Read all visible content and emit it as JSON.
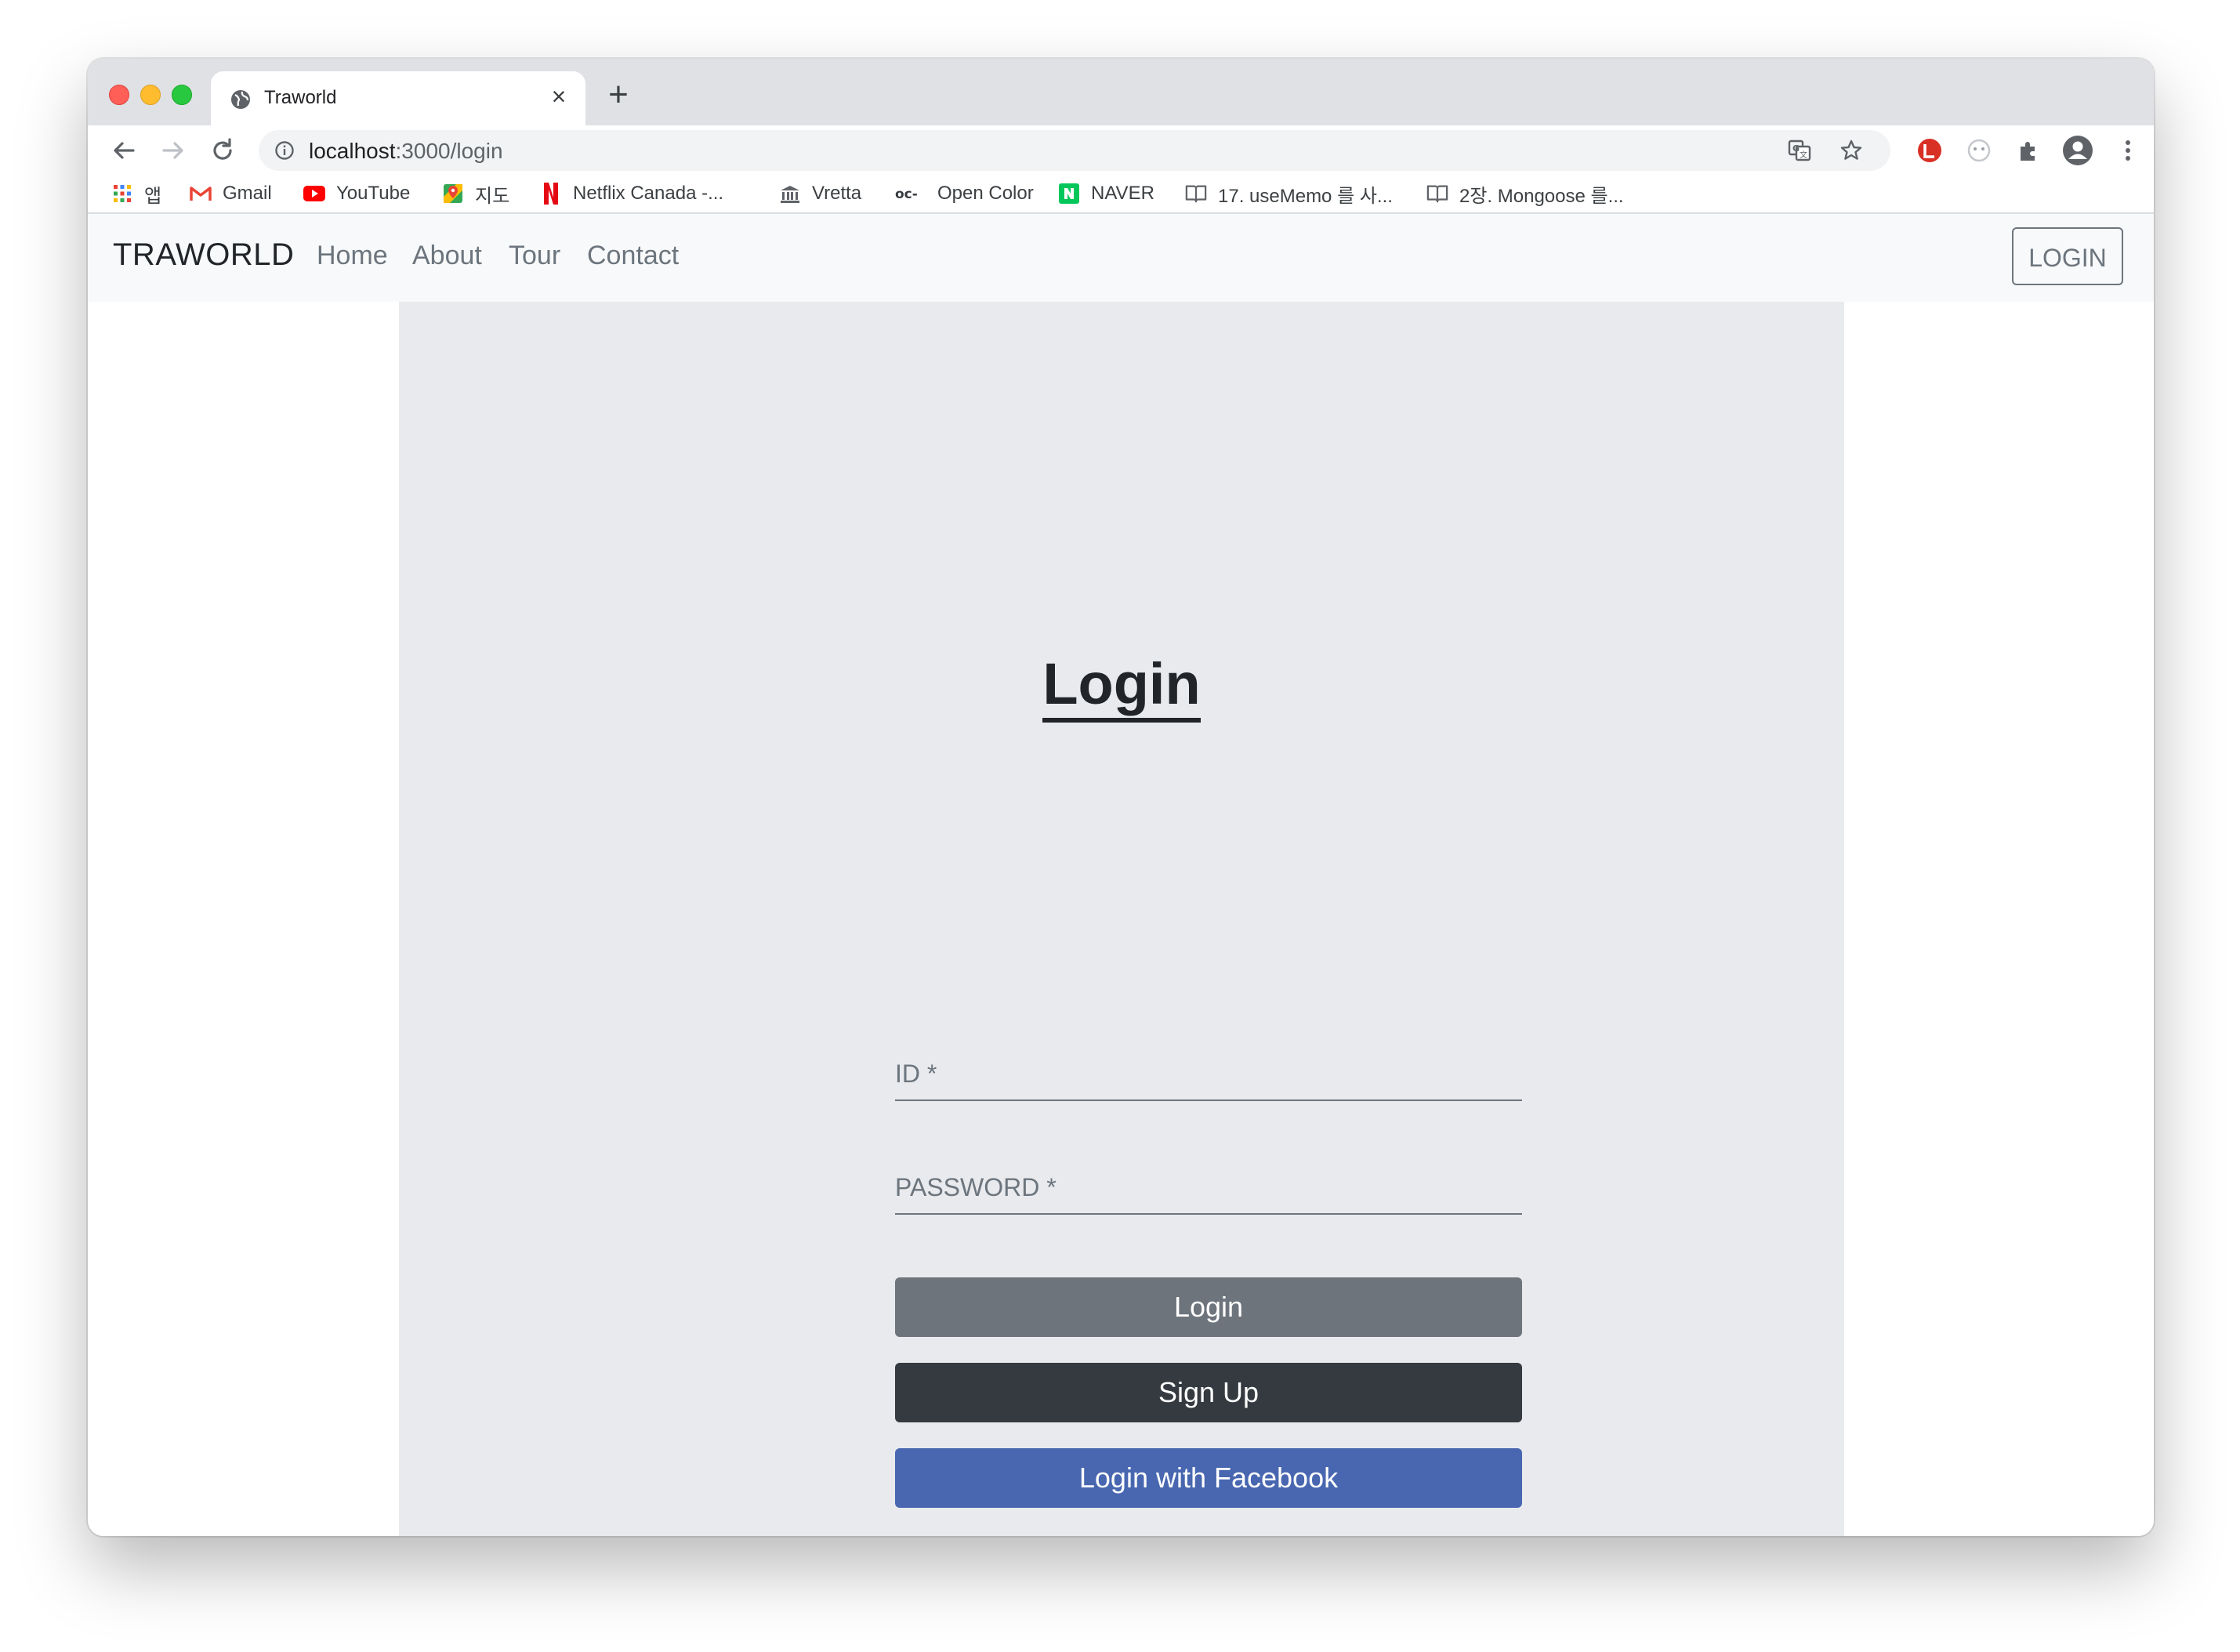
{
  "browser": {
    "tab_title": "Traworld",
    "url_host": "localhost",
    "url_path": ":3000/login",
    "bookmarks": [
      {
        "label": "앱",
        "icon": "apps-grid-icon"
      },
      {
        "label": "Gmail",
        "icon": "gmail-icon"
      },
      {
        "label": "YouTube",
        "icon": "youtube-icon"
      },
      {
        "label": "지도",
        "icon": "maps-icon"
      },
      {
        "label": "Netflix Canada -...",
        "icon": "netflix-icon"
      },
      {
        "label": "Vretta",
        "icon": "bank-icon"
      },
      {
        "label": "Open Color",
        "icon": "open-color-icon"
      },
      {
        "label": "NAVER",
        "icon": "naver-icon"
      },
      {
        "label": "17. useMemo 를 사...",
        "icon": "book-icon"
      },
      {
        "label": "2장. Mongoose 를...",
        "icon": "book-icon"
      }
    ]
  },
  "navbar": {
    "brand": "TRAWORLD",
    "links": [
      "Home",
      "About",
      "Tour",
      "Contact"
    ],
    "login_button": "LOGIN"
  },
  "login": {
    "heading": "Login",
    "id_label": "ID *",
    "password_label": "PASSWORD *",
    "login_button": "Login",
    "signup_button": "Sign Up",
    "facebook_button": "Login with Facebook"
  },
  "colors": {
    "navbar_bg": "#f8f9fa",
    "panel_bg": "#e9eaee",
    "login_btn": "#6e747c",
    "signup_btn": "#343a40",
    "facebook_btn": "#4867b0"
  }
}
